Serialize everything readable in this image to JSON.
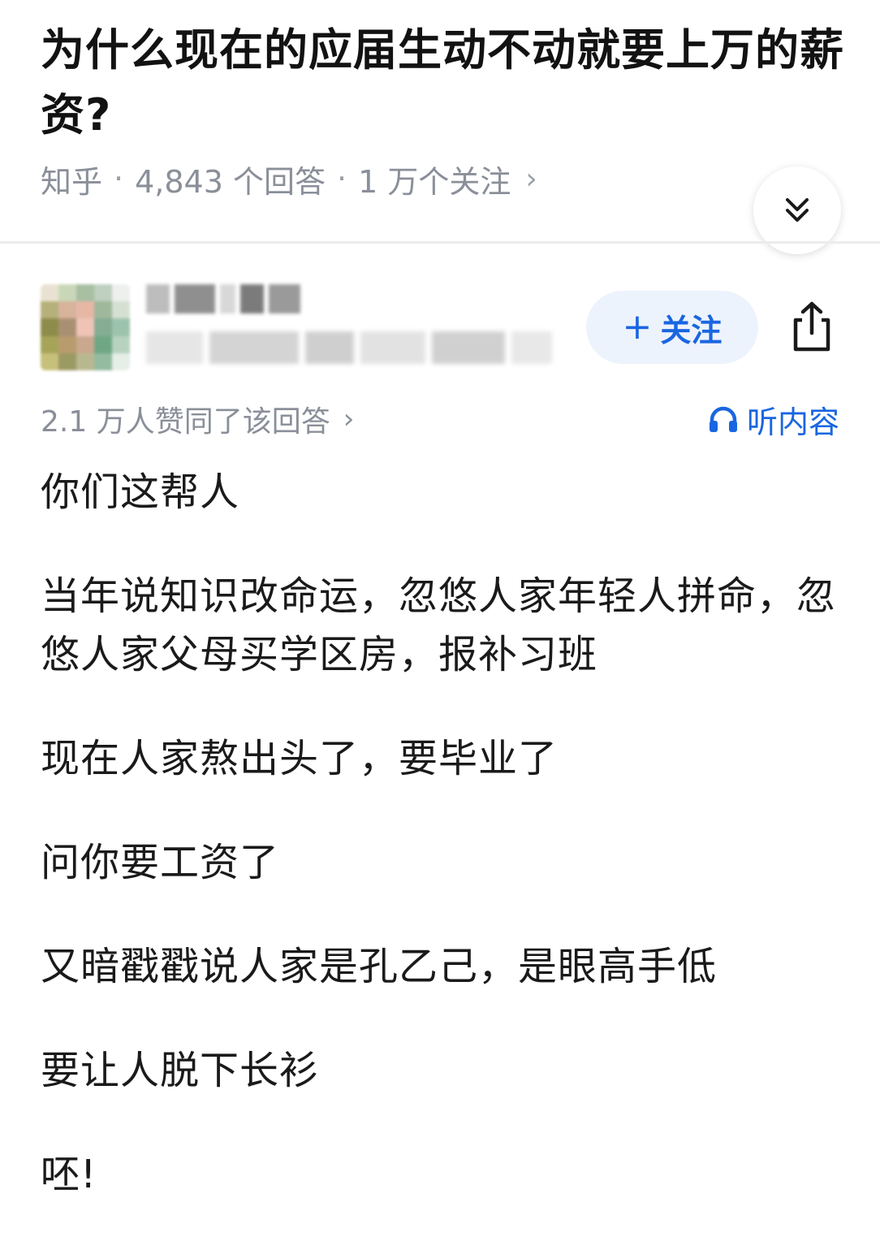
{
  "question": {
    "title": "为什么现在的应届生动不动就要上万的薪资?",
    "source": "知乎",
    "answer_count": "4,843 个回答",
    "follow_count": "1 万个关注",
    "meta_arrow": "›"
  },
  "author": {
    "follow_label": "关注",
    "follow_plus": "+"
  },
  "answer": {
    "upvotes": "2.1 万人赞同了该回答",
    "upvotes_arrow": "›",
    "listen_label": "听内容",
    "paragraphs": [
      "你们这帮人",
      "当年说知识改命运，忽悠人家年轻人拼命，忽悠人家父母买学区房，报补习班",
      "现在人家熬出头了，要毕业了",
      "问你要工资了",
      "又暗戳戳说人家是孔乙己，是眼高手低",
      "要让人脱下长衫",
      "呸!"
    ]
  },
  "icons": {
    "collapse": "double-chevron-down-icon",
    "share": "share-icon",
    "listen": "headphones-icon"
  },
  "colors": {
    "accent": "#1a66e0",
    "follow_bg": "#edf3fc",
    "meta_text": "#8a8f99",
    "body_text": "#1a1a1a"
  }
}
